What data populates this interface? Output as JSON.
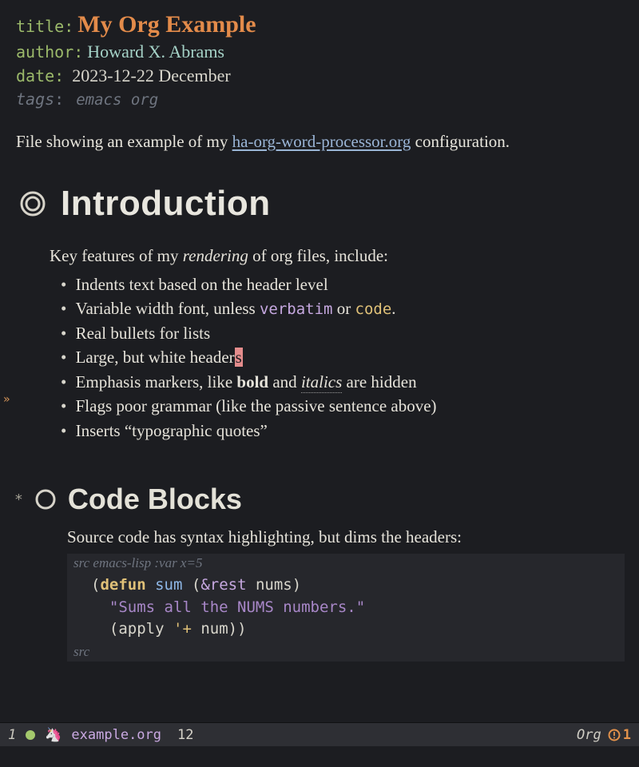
{
  "meta": {
    "title_key": "title",
    "title": "My Org Example",
    "author_key": "author",
    "author": "Howard X. Abrams",
    "date_key": "date",
    "date": "2023-12-22 December",
    "tags_key": "tags",
    "tags": "emacs org"
  },
  "intro": {
    "before_link": "File showing an example of my ",
    "link_text": "ha-org-word-processor.org",
    "after_link": " configuration."
  },
  "sections": {
    "introduction": {
      "heading": "Introduction",
      "lede_before": "Key features of my ",
      "lede_italic": "rendering",
      "lede_after": " of org files, include:",
      "bullets": [
        {
          "text": "Indents text based on the header level"
        },
        {
          "before": "Variable width font, unless ",
          "verbatim": "verbatim",
          "mid": " or ",
          "code": "code",
          "after": "."
        },
        {
          "text": "Real bullets for lists"
        },
        {
          "before": "Large, but white header",
          "cursor": "s"
        },
        {
          "before": "Emphasis markers, like ",
          "bold": "bold",
          "mid": " and ",
          "italic": "italics",
          "after_dotted": " are hidden"
        },
        {
          "text": "Flags poor grammar (like the passive sentence above)"
        },
        {
          "text": "Inserts “typographic quotes”"
        }
      ]
    },
    "code_blocks": {
      "heading": "Code Blocks",
      "para": "Source code has syntax highlighting, but dims the headers:",
      "begin_kw": "src",
      "begin_args": " emacs-lisp :var x=5",
      "end_kw": "src",
      "code": {
        "l1_open": "(",
        "l1_defun": "defun",
        "l1_sp": " ",
        "l1_name": "sum",
        "l1_sp2": " (",
        "l1_amp": "&rest",
        "l1_sp3": " ",
        "l1_arg": "nums",
        "l1_close": ")",
        "l2_indent": "  ",
        "l2_doc": "\"Sums all the NUMS numbers.\"",
        "l3_indent": "  ",
        "l3_open": "(",
        "l3_apply": "apply",
        "l3_sp": " ",
        "l3_quote": "'+",
        "l3_sp2": " ",
        "l3_arg": "num",
        "l3_close": "))"
      }
    }
  },
  "fringe_marker": "»",
  "modeline": {
    "window_number": "1",
    "unicorn": "🦄",
    "filename": "example.org",
    "line": "12",
    "major_mode": "Org",
    "warn_count": "1"
  }
}
